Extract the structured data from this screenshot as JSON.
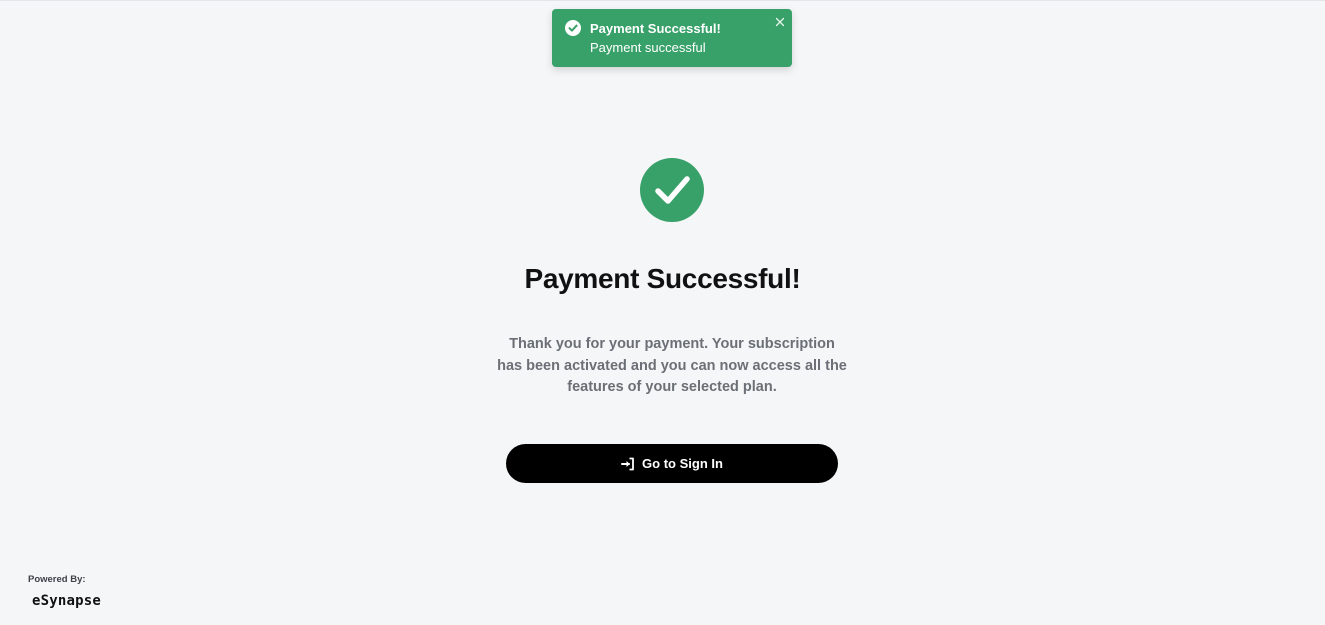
{
  "toast": {
    "title": "Payment Successful!",
    "message": "Payment successful",
    "icon": "check-circle-icon",
    "close_icon": "close-icon",
    "color": "#38a169"
  },
  "main": {
    "icon": "check-circle-icon",
    "icon_color": "#38a169",
    "title": "Payment Successful!",
    "message": "Thank you for your payment. Your subscription has been activated and you can now access all the features of your selected plan.",
    "button": {
      "label": "Go to Sign In",
      "icon": "sign-in-icon"
    }
  },
  "footer": {
    "powered_by": "Powered By:",
    "brand": "eSynapse"
  }
}
